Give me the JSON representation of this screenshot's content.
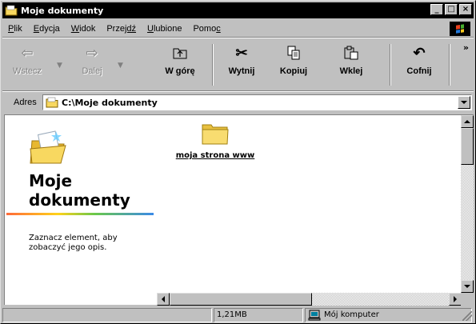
{
  "window": {
    "title": "Moje dokumenty"
  },
  "window_controls": {
    "minimize": "_",
    "maximize": "□",
    "close": "×"
  },
  "menu": [
    {
      "underline": "P",
      "rest": "lik"
    },
    {
      "underline": "E",
      "rest": "dycja"
    },
    {
      "underline": "W",
      "rest": "idok"
    },
    {
      "pre": "Prze",
      "underline": "jdź",
      "rest": ""
    },
    {
      "underline": "U",
      "rest": "lubione"
    },
    {
      "pre": "Pomo",
      "underline": "c",
      "rest": ""
    }
  ],
  "menu_labels": [
    "Plik",
    "Edycja",
    "Widok",
    "Przejdź",
    "Ulubione",
    "Pomoc"
  ],
  "toolbar": {
    "back": "Wstecz",
    "forward": "Dalej",
    "up": "W górę",
    "cut": "Wytnij",
    "copy": "Kopiuj",
    "paste": "Wklej",
    "undo": "Cofnij",
    "more": "»"
  },
  "address": {
    "label": "Adres",
    "value": "C:\\Moje dokumenty"
  },
  "left_pane": {
    "title_line1": "Moje",
    "title_line2": "dokumenty",
    "description_line1": "Zaznacz element, aby",
    "description_line2": "zobaczyć jego opis."
  },
  "files": [
    {
      "name": "moja strona www",
      "icon": "folder-icon"
    }
  ],
  "status": {
    "size": "1,21MB",
    "location": "Mój komputer"
  },
  "colors": {
    "titlebar": "#000000",
    "chrome": "#c0c0c0",
    "folder": "#f8d860"
  }
}
